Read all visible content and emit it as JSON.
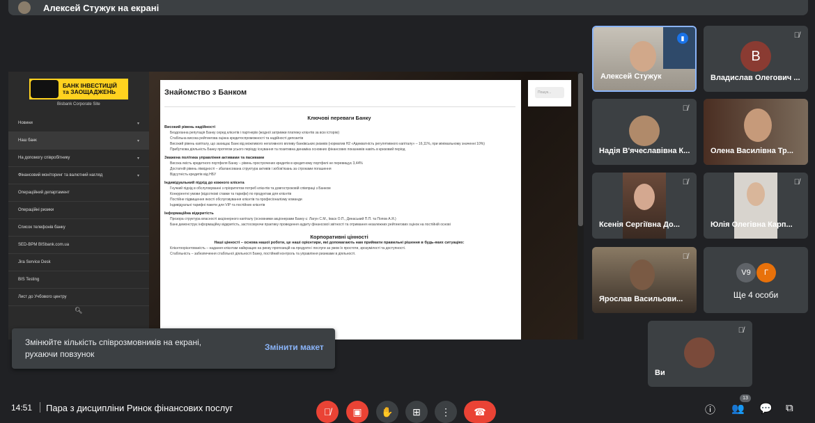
{
  "presenter_bar": {
    "title": "Алексей Стужук на екрані"
  },
  "site": {
    "logo_text": "БАНК ІНВЕСТИЦІЙ та ЗАОЩАДЖЕНЬ",
    "corporate_site": "Bisbank Corporate Site",
    "menu": [
      {
        "label": "Новини"
      },
      {
        "label": "Наш банк"
      },
      {
        "label": "На допомогу співробітнику"
      },
      {
        "label": "Фінансовий моніторинг та валютний нагляд"
      },
      {
        "label": "Операційний департамент"
      },
      {
        "label": "Операційні ризики"
      },
      {
        "label": "Список телефонів банку"
      },
      {
        "label": "SED-BPM BISbank.com.ua"
      },
      {
        "label": "Jira Service Desk"
      },
      {
        "label": "BIS Testing"
      },
      {
        "label": "Лист до Учбового центру"
      }
    ],
    "search_placeholder": "Пошук...",
    "doc": {
      "title": "Знайомство з Банком",
      "heading1": "Ключові переваги Банку",
      "sections": [
        {
          "title": "Високий рівень надійності",
          "items": [
            "Бездоганна репутація Банку серед клієнтів і партнерів (жодної затримки платежу клієнтів за всю історію)",
            "Стабільна висока рейтингова оцінка кредитоспроможності та надійності депозитів",
            "Високий рівень капіталу, що захищає Банк від можливого негативного впливу банківських ризиків (норматив Н2 «Адекватність регулятивного капіталу» – 16,11%, при мінімальному значенні 10%)",
            "Прибуткова діяльність Банку протягом усього періоду існування та позитивна динаміка основних фінансових показників навіть в кризовий період"
          ]
        },
        {
          "title": "Зважена політика управління активами та пасивами",
          "items": [
            "Висока якість кредитного портфеля Банку – рівень прострочених кредитів в кредитному портфелі не перевищує 3,44%",
            "Достатній рівень ліквідності – збалансована структура активів і зобов'язань за строками погашення",
            "Відсутність кредитів від НБУ"
          ]
        },
        {
          "title": "Індивідуальний підхід до кожного клієнта",
          "items": [
            "Гнучкий підхід в обслуговуванні з пріоритетом потреб клієнтів та довгостроковій співпраці з Банком",
            "Конкурентні умови (відсоткові ставки та тарифи) по продуктам для клієнтів",
            "Постійне підвищення якості обслуговування клієнтів та професіоналізму команди",
            "Індивідуальні тарифні пакети для VIP та постійних клієнтів"
          ]
        },
        {
          "title": "Інформаційна відкритість",
          "items": [
            "Прозора структура власності акціонерного капіталу (основними акціонерами Банку є: Лагун С.М., Іваск О.П., Динаський П.П. та Попов А.Я.)",
            "Банк демонструє інформаційну відкритість, застосовуючи практику проведення аудиту фінансової звітності та отримання незалежних рейтингових оцінок на постійній основі"
          ]
        }
      ],
      "heading2": "Корпоративні цінності",
      "values_intro": "Наші цінності – основа нашої роботи, це наші орієнтири, які допомагають нам приймати правильні рішення в будь-яких ситуаціях:",
      "value1": "Клієнтоорієнтованість – надання клієнтам найкращих на ринку пропозицій на продукти і послуги за умов їх простоти, зрозумілості та доступності.",
      "value2": "Стабільність – забезпечення стабільної діяльності Банку, постійний контроль та управління ризиками в діяльності."
    }
  },
  "participants": [
    {
      "name": "Алексей Стужук"
    },
    {
      "name": "Владислав Олегович ...",
      "letter": "В"
    },
    {
      "name": "Надія В'ячеславівна К..."
    },
    {
      "name": "Олена Василівна Тр..."
    },
    {
      "name": "Ксенія Сергіївна До..."
    },
    {
      "name": "Юлія Олегівна Карп..."
    },
    {
      "name": "Ярослав Васильови..."
    }
  ],
  "more_tile": {
    "label": "Ще 4 особи",
    "avatar1": "V9",
    "avatar2": "Г"
  },
  "self_tile": {
    "name": "Ви"
  },
  "toast": {
    "message": "Змінюйте кількість співрозмовників на екрані, рухаючи повзунок",
    "action": "Змінити макет"
  },
  "bottom": {
    "time": "14:51",
    "meeting": "Пара з дисципліни Ринок фінансових послуг",
    "people_count": "13"
  },
  "colors": {
    "accent": "#8ab4f8",
    "danger": "#ea4335",
    "tile": "#3c4043",
    "bg": "#202124",
    "brand_yellow": "#ffd21f"
  }
}
